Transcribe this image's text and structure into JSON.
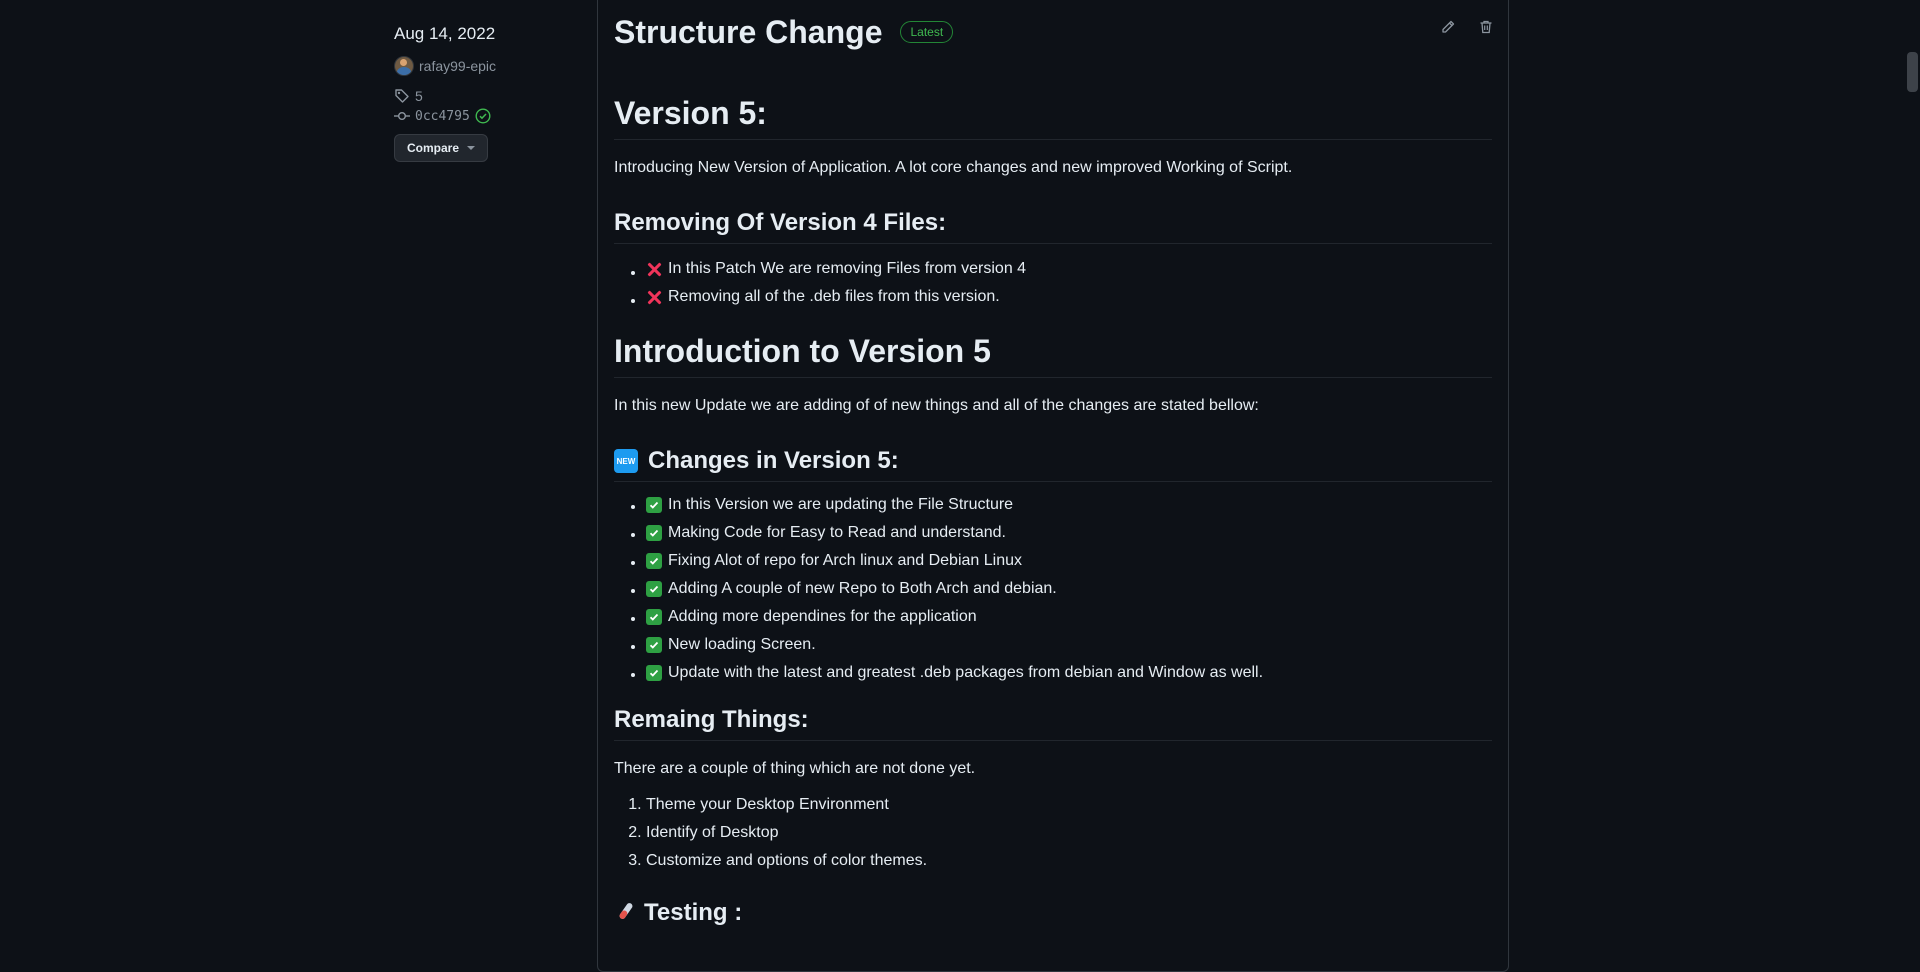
{
  "sidebar": {
    "date": "Aug 14, 2022",
    "author": "rafay99-epic",
    "tag": "5",
    "commit": "0cc4795",
    "compare_label": "Compare"
  },
  "release": {
    "title": "Structure Change",
    "badge": "Latest",
    "h_version": "Version 5:",
    "p_intro": "Introducing New Version of Application. A lot core changes and new improved Working of Script.",
    "h_removing": "Removing Of Version 4 Files:",
    "removing_items": [
      "In this Patch We are removing Files from version 4",
      "Removing all of the .deb files from this version."
    ],
    "h_introduction": "Introduction to Version 5",
    "p_update": "In this new Update we are adding of of new things and all of the changes are stated bellow:",
    "new_badge": "NEW",
    "h_changes": "Changes in Version 5:",
    "changes_items": [
      "In this Version we are updating the File Structure",
      "Making Code for Easy to Read and understand.",
      "Fixing Alot of repo for Arch linux and Debian Linux",
      "Adding A couple of new Repo to Both Arch and debian.",
      "Adding more dependines for the application",
      "New loading Screen.",
      "Update with the latest and greatest .deb packages from debian and Window as well."
    ],
    "h_remaining": "Remaing Things:",
    "p_remaining": "There are a couple of thing which are not done yet.",
    "remaining_items": [
      "Theme your Desktop Environment",
      "Identify of Desktop",
      "Customize and options of color themes."
    ],
    "h_testing": "Testing :"
  },
  "colors": {
    "background": "#0d1117",
    "border": "#30363d",
    "latest": "#3fb950",
    "check": "#2ea043",
    "cross": "#f0345a",
    "new_badge": "#1d9bf0"
  },
  "icons": [
    "tag-icon",
    "commit-icon",
    "check-circle-icon",
    "pencil-icon",
    "trash-icon",
    "cross-mark-icon",
    "check-box-icon",
    "new-badge-icon",
    "test-tube-icon"
  ]
}
